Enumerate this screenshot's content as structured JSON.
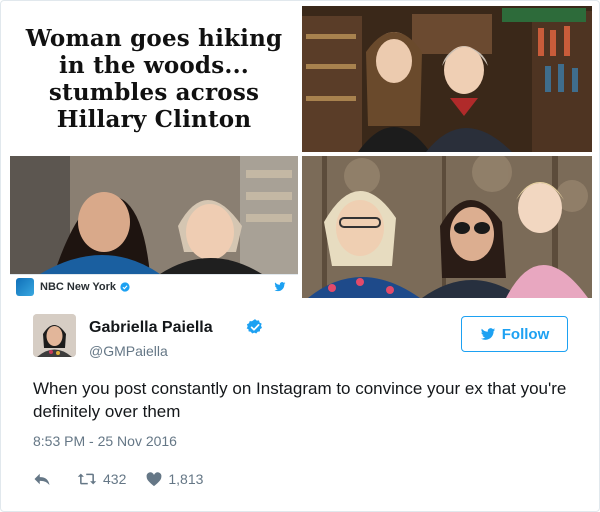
{
  "collage": {
    "headline": "Woman goes hiking in the woods... stumbles across Hillary Clinton",
    "embed_source": "NBC New York",
    "embed_logo_text": "4"
  },
  "tweet": {
    "display_name": "Gabriella Paiella",
    "handle": "@GMPaiella",
    "follow_label": "Follow",
    "text": "When you post constantly on Instagram to convince your ex that you're definitely over them",
    "timestamp": "8:53 PM - 25 Nov 2016",
    "retweets": "432",
    "likes": "1,813"
  },
  "icons": {
    "verified": "verified-badge-icon",
    "follow": "twitter-bird-icon",
    "reply": "reply-icon",
    "retweet": "retweet-icon",
    "like": "heart-icon"
  },
  "colors": {
    "brand_blue": "#1da1f2",
    "text_primary": "#14171a",
    "text_secondary": "#657786",
    "border": "#e1e8ed"
  }
}
